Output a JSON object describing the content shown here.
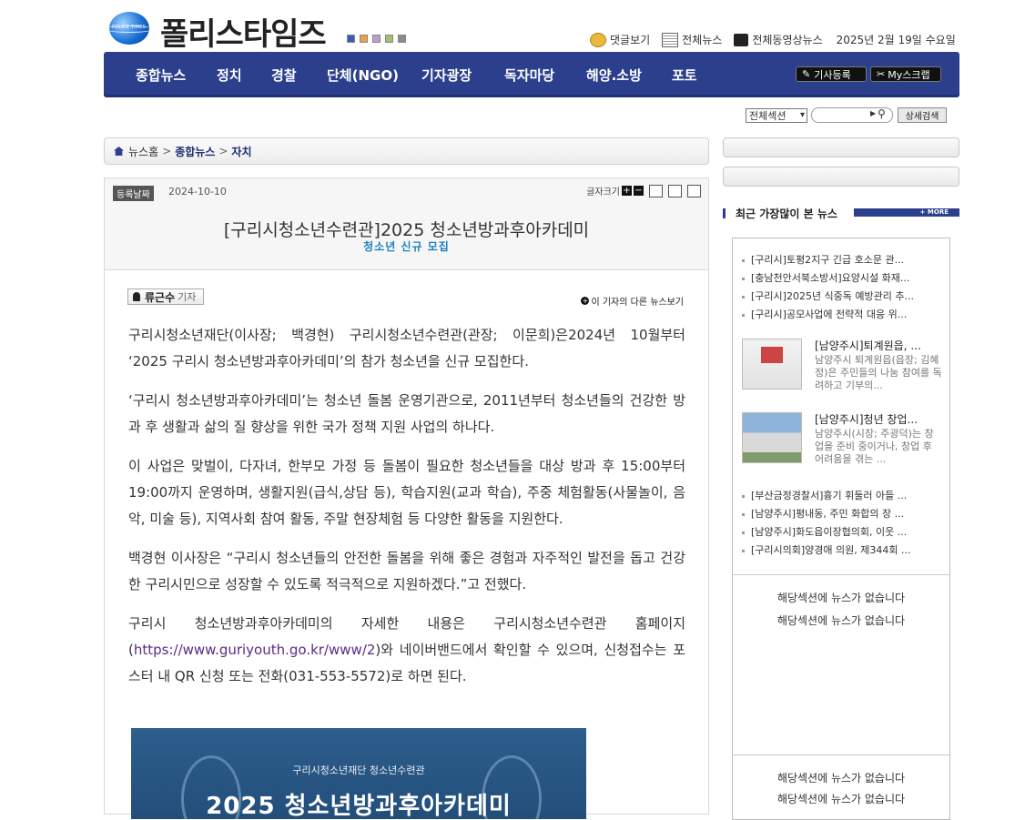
{
  "header": {
    "logo_text": "폴리스타임즈",
    "logo_sub": "POLICE TIMES",
    "theme_colors": [
      "#3b5bb5",
      "#e8a050",
      "#b8a0d0",
      "#a0c070",
      "#8c8c8c"
    ],
    "links": [
      {
        "label": "댓글보기",
        "icon": "comment-icon"
      },
      {
        "label": "전체뉴스",
        "icon": "news-list-icon"
      },
      {
        "label": "전체동영상뉴스",
        "icon": "video-icon"
      }
    ],
    "date": "2025년 2월 19일 수요일"
  },
  "nav": {
    "items": [
      "종합뉴스",
      "정치",
      "경찰",
      "단체(NGO)",
      "기자광장",
      "독자마당",
      "해양.소방",
      "포토"
    ],
    "register_label": "기사등록",
    "scrap_label": "My스크랩",
    "color": "#2b3f8c"
  },
  "search": {
    "section_value": "전체섹션",
    "detail_label": "상세검색"
  },
  "breadcrumb": {
    "home": "뉴스홈",
    "section": "종합뉴스",
    "sub": "자치"
  },
  "article": {
    "reg_label": "등록날짜",
    "reg_date": "2024-10-10",
    "font_size_label": "글자크기",
    "title": "[구리시청소년수련관]2025 청소년방과후아카데미",
    "subtitle": "청소년 신규 모집",
    "reporter_name": "류근수",
    "reporter_role": "기자",
    "more_by_reporter": "이 기자의 다른 뉴스보기",
    "paragraphs": [
      "구리시청소년재단(이사장; 백경현) 구리시청소년수련관(관장; 이문희)은2024년 10월부터 ‘2025 구리시 청소년방과후아카데미’의 참가 청소년을 신규 모집한다.",
      "‘구리시 청소년방과후아카데미’는 청소년 돌봄 운영기관으로, 2011년부터 청소년들의 건강한 방과 후 생활과 삶의 질 향상을 위한 국가 정책 지원 사업의 하나다.",
      "이 사업은 맞벌이, 다자녀, 한부모 가정 등 돌봄이 필요한 청소년들을 대상 방과 후 15:00부터 19:00까지 운영하며, 생활지원(급식,상담 등), 학습지원(교과 학습), 주중 체험활동(사물놀이, 음악, 미술 등), 지역사회 참여 활동, 주말 현장체험 등 다양한 활동을 지원한다.",
      "백경현 이사장은 “구리시 청소년들의 안전한 돌봄을 위해 좋은 경험과 자주적인 발전을 돕고 건강한 구리시민으로 성장할 수 있도록 적극적으로 지원하겠다.”고 전했다."
    ],
    "last_paragraph_before": "구리시 청소년방과후아카데미의 자세한 내용은 구리시청소년수련관 홈페이지(",
    "last_paragraph_link": "https://www.guriyouth.go.kr/www/2",
    "last_paragraph_after": ")와 네이버밴드에서 확인할 수 있으며, 신청접수는 포스터 내 QR 신청 또는 전화(031-553-5572)로 하면 된다.",
    "poster_line1": "구리시청소년재단 청소년수련관",
    "poster_line2": "2025 청소년방과후아카데미"
  },
  "sidebar": {
    "popular_title": "최근 가장많이 본 뉴스",
    "more_label": "+ MORE",
    "top_list": [
      "[구리시]토평2지구 긴급 호소문 관...",
      "[충남천안서북소방서]요양시설 화재...",
      "[구리시]2025년 식중독 예방관리 추...",
      "[구리시]공모사업에 전략적 대응 위..."
    ],
    "thumb_items": [
      {
        "title": "[남양주시]퇴계원읍, ...",
        "desc": "남양주시 퇴계원읍(읍장; 김혜정)은 주민들의 나눔 참여를 독려하고 기부의..."
      },
      {
        "title": "[남양주시]청년 창업...",
        "desc": "남양주시(시장; 주광덕)는 창업을 준비 중이거나, 창업 후 어려움을 겪는 ..."
      }
    ],
    "bottom_list": [
      "[부산금정경찰서]흉기 휘둘러 아들 ...",
      "[남양주시]평내동, 주민 화합의 장 ...",
      "[남양주시]화도읍이장협의회, 이웃 ...",
      "[구리시의회]양경애 의원, 제344회 ..."
    ],
    "empty_message": "해당섹션에 뉴스가 없습니다"
  }
}
